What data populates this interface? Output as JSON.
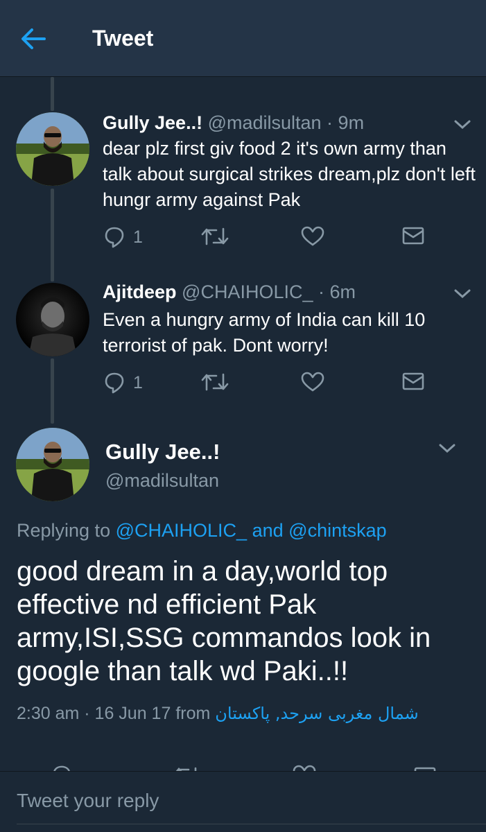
{
  "header": {
    "title": "Tweet"
  },
  "tweets": [
    {
      "name": "Gully Jee..!",
      "meta": "@madilsultan · 9m",
      "text": "dear plz first giv food 2 it's own army than talk about surgical strikes dream,plz don't left hungr army against Pak",
      "reply_count": "1"
    },
    {
      "name": "Ajitdeep",
      "meta": "@CHAIHOLIC_ · 6m",
      "text": "Even a hungry army of India can kill 10 terrorist of pak. Dont worry!",
      "reply_count": "1"
    }
  ],
  "main": {
    "name": "Gully Jee..!",
    "handle": "@madilsultan",
    "replying_prefix": "Replying to",
    "replying_user1": "@CHAIHOLIC_",
    "replying_and": "and",
    "replying_user2": "@chintskap",
    "text": "good dream in a day,world top effective nd efficient Pak army,ISI,SSG commandos look in google than talk wd Paki..!!",
    "time": "2:30 am · 16 Jun 17",
    "from_label": "from",
    "location": "شمال مغربی سرحد, پاکستان"
  },
  "reply": {
    "placeholder": "Tweet your reply"
  },
  "colors": {
    "background": "#1b2836",
    "header": "#243447",
    "accent": "#1da1f2",
    "muted": "#8899a6"
  },
  "icons": [
    "back-arrow-icon",
    "chevron-down-icon",
    "reply-icon",
    "retweet-icon",
    "like-icon",
    "direct-message-icon"
  ]
}
